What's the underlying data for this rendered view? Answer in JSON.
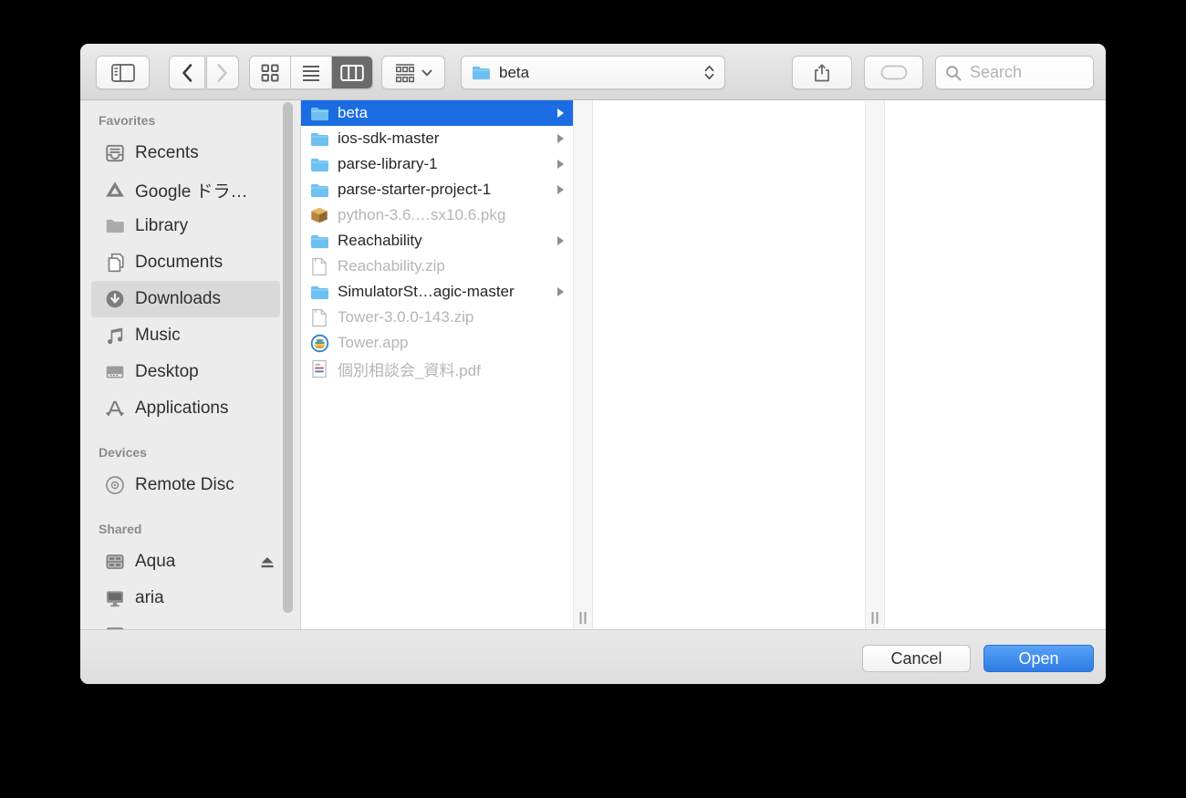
{
  "dialog": {
    "toolbar": {
      "buttons": {
        "sidebar_toggle_icon": "sidebar-toggle-icon",
        "back_icon": "back-icon",
        "forward_icon": "forward-icon",
        "view_modes": [
          {
            "name": "icon-view",
            "icon": "grid-view-icon",
            "active": false
          },
          {
            "name": "list-view",
            "icon": "list-view-icon",
            "active": false
          },
          {
            "name": "column-view",
            "icon": "column-view-icon",
            "active": true
          }
        ],
        "group_icon": "group-icon",
        "share_icon": "share-icon",
        "tag_icon": "tag-icon"
      },
      "popup": {
        "label": "beta",
        "icon": "folder-file-icon"
      },
      "search": {
        "placeholder": "Search",
        "icon": "search-icon"
      }
    },
    "sidebar": {
      "sections": [
        {
          "title": "Favorites",
          "items": [
            {
              "label": "Recents",
              "icon": "recents-icon"
            },
            {
              "label": "Google ドラ…",
              "icon": "gdrive-icon"
            },
            {
              "label": "Library",
              "icon": "library-folder-icon"
            },
            {
              "label": "Documents",
              "icon": "documents-icon"
            },
            {
              "label": "Downloads",
              "icon": "downloads-icon",
              "selected": true
            },
            {
              "label": "Music",
              "icon": "music-icon"
            },
            {
              "label": "Desktop",
              "icon": "desktop-icon"
            },
            {
              "label": "Applications",
              "icon": "applications-icon"
            }
          ]
        },
        {
          "title": "Devices",
          "items": [
            {
              "label": "Remote Disc",
              "icon": "disc-icon"
            }
          ]
        },
        {
          "title": "Shared",
          "items": [
            {
              "label": "Aqua",
              "icon": "server-icon",
              "eject": true
            },
            {
              "label": "aria",
              "icon": "display-icon"
            },
            {
              "label": "",
              "icon": "server-icon",
              "partial": true
            }
          ]
        }
      ]
    },
    "files": [
      {
        "name": "beta",
        "icon": "folder-file-icon",
        "type": "folder",
        "selected": true
      },
      {
        "name": "ios-sdk-master",
        "icon": "folder-file-icon",
        "type": "folder"
      },
      {
        "name": "parse-library-1",
        "icon": "folder-file-icon",
        "type": "folder"
      },
      {
        "name": "parse-starter-project-1",
        "icon": "folder-file-icon",
        "type": "folder"
      },
      {
        "name": "python-3.6.…sx10.6.pkg",
        "icon": "pkg-file-icon",
        "type": "file",
        "dimmed": true
      },
      {
        "name": "Reachability",
        "icon": "folder-file-icon",
        "type": "folder"
      },
      {
        "name": "Reachability.zip",
        "icon": "zip-file-icon",
        "type": "file",
        "dimmed": true
      },
      {
        "name": "SimulatorSt…agic-master",
        "icon": "folder-file-icon",
        "type": "folder"
      },
      {
        "name": "Tower-3.0.0-143.zip",
        "icon": "zip-file-icon",
        "type": "file",
        "dimmed": true
      },
      {
        "name": "Tower.app",
        "icon": "tower-app-icon",
        "type": "file",
        "dimmed": true
      },
      {
        "name": "個別相談会_資料.pdf",
        "icon": "pdf-file-icon",
        "type": "file",
        "dimmed": true
      }
    ],
    "footer": {
      "cancel_label": "Cancel",
      "open_label": "Open"
    },
    "colors": {
      "selection_blue": "#1c6ce3",
      "sidebar_selection": "#d9d9d9",
      "open_button_top": "#58a1f5",
      "open_button_bottom": "#2d7ce5",
      "folder_blue": "#6dc0f0",
      "dimmed_text": "#b5b5b5"
    }
  }
}
